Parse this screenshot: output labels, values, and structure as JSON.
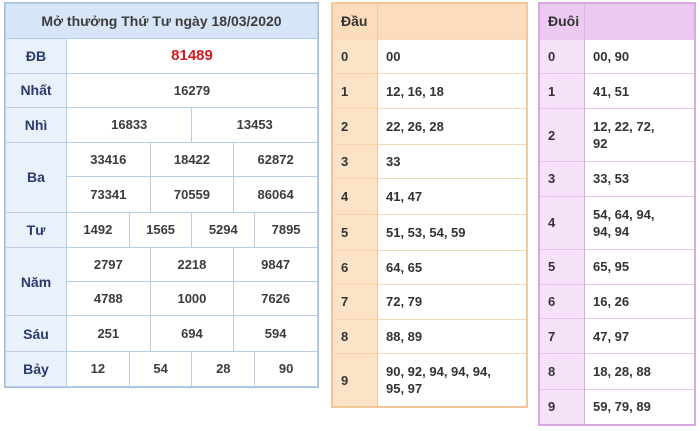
{
  "results": {
    "title": "Mở thưởng Thứ Tư ngày 18/03/2020",
    "rows": {
      "db": {
        "label": "ĐB",
        "values": [
          "81489"
        ]
      },
      "nhat": {
        "label": "Nhất",
        "values": [
          "16279"
        ]
      },
      "nhi": {
        "label": "Nhì",
        "values": [
          "16833",
          "13453"
        ]
      },
      "ba": {
        "label": "Ba",
        "values": [
          "33416",
          "18422",
          "62872",
          "73341",
          "70559",
          "86064"
        ]
      },
      "tu": {
        "label": "Tư",
        "values": [
          "1492",
          "1565",
          "5294",
          "7895"
        ]
      },
      "nam": {
        "label": "Năm",
        "values": [
          "2797",
          "2218",
          "9847",
          "4788",
          "1000",
          "7626"
        ]
      },
      "sau": {
        "label": "Sáu",
        "values": [
          "251",
          "694",
          "594"
        ]
      },
      "bay": {
        "label": "Bảy",
        "values": [
          "12",
          "54",
          "28",
          "90"
        ]
      }
    },
    "colors": {
      "accent": "#d6e5f7",
      "special_prize": "#d6181f"
    }
  },
  "dau": {
    "header": "Đầu",
    "rows": [
      {
        "k": "0",
        "v": "00"
      },
      {
        "k": "1",
        "v": "12, 16, 18"
      },
      {
        "k": "2",
        "v": "22, 26, 28"
      },
      {
        "k": "3",
        "v": "33"
      },
      {
        "k": "4",
        "v": "41, 47"
      },
      {
        "k": "5",
        "v": "51, 53, 54, 59"
      },
      {
        "k": "6",
        "v": "64, 65"
      },
      {
        "k": "7",
        "v": "72, 79"
      },
      {
        "k": "8",
        "v": "88, 89"
      },
      {
        "k": "9",
        "v": "90, 92, 94, 94, 94,",
        "v2": "95, 97"
      }
    ],
    "colors": {
      "accent": "#fbdcbc"
    }
  },
  "duoi": {
    "header": "Đuôi",
    "rows": [
      {
        "k": "0",
        "v": "00, 90"
      },
      {
        "k": "1",
        "v": "41, 51"
      },
      {
        "k": "2",
        "v": "12, 22, 72,",
        "v2": "92"
      },
      {
        "k": "3",
        "v": "33, 53"
      },
      {
        "k": "4",
        "v": "54, 64, 94,",
        "v2": "94, 94"
      },
      {
        "k": "5",
        "v": "65, 95"
      },
      {
        "k": "6",
        "v": "16, 26"
      },
      {
        "k": "7",
        "v": "47, 97"
      },
      {
        "k": "8",
        "v": "18, 28, 88"
      },
      {
        "k": "9",
        "v": "59, 79, 89"
      }
    ],
    "colors": {
      "accent": "#ecc9f0"
    }
  }
}
